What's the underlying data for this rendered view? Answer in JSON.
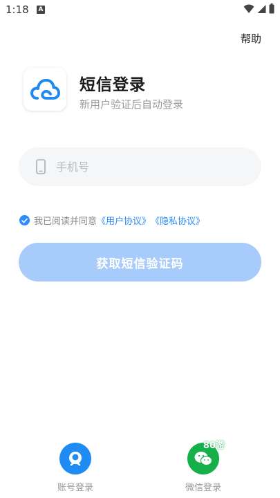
{
  "status_bar": {
    "time": "1:18",
    "notification_letter": "A"
  },
  "help_label": "帮助",
  "title": "短信登录",
  "subtitle": "新用户验证后自动登录",
  "phone_input": {
    "placeholder": "手机号",
    "value": ""
  },
  "agreement": {
    "checked": true,
    "prefix": "我已阅读并同意",
    "user_agreement": "《用户协议》",
    "privacy_agreement": "《隐私协议》"
  },
  "get_code_label": "获取短信验证码",
  "alt_logins": {
    "account_label": "账号登录",
    "wechat_label": "微信登录",
    "watermark": "80游"
  },
  "colors": {
    "accent": "#2a8cff",
    "button_disabled": "#a7cbfa",
    "wechat": "#16b04b",
    "account": "#1f8cf3"
  }
}
